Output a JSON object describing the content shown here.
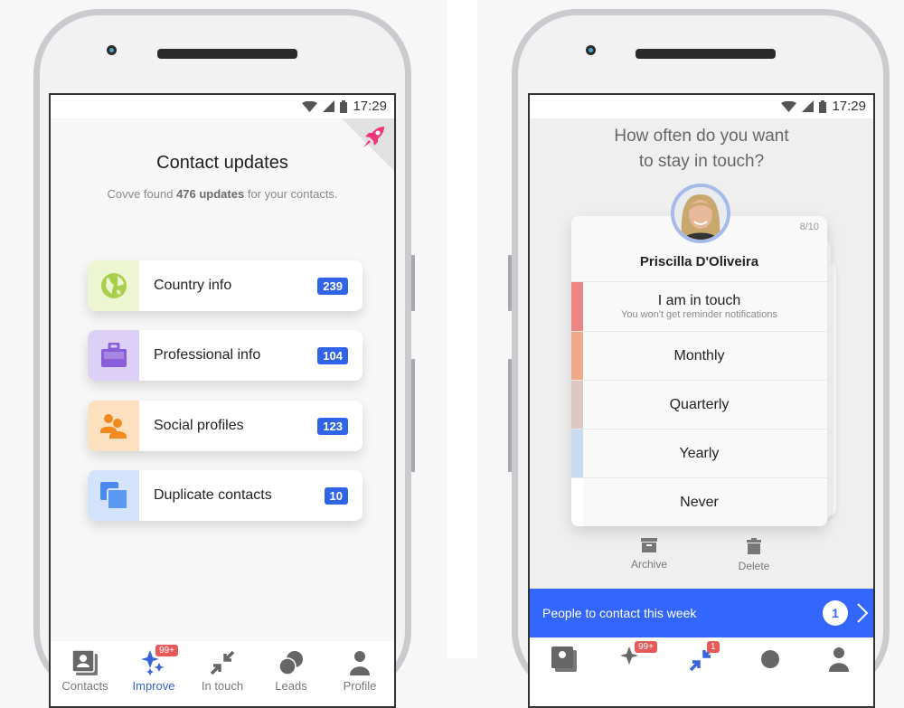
{
  "status_bar": {
    "time": "17:29"
  },
  "left_screen": {
    "title": "Contact updates",
    "subtitle_prefix": "Covve found ",
    "subtitle_bold": "476 updates",
    "subtitle_suffix": " for your contacts.",
    "cards": [
      {
        "label": "Country info",
        "count": "239",
        "icon": "globe-icon",
        "icon_bg": "#eef5d3",
        "icon_color": "#a8cf4c"
      },
      {
        "label": "Professional info",
        "count": "104",
        "icon": "briefcase-icon",
        "icon_bg": "#ddd0f6",
        "icon_color": "#8a5ed8"
      },
      {
        "label": "Social profiles",
        "count": "123",
        "icon": "people-icon",
        "icon_bg": "#fde0c0",
        "icon_color": "#f08a1e"
      },
      {
        "label": "Duplicate contacts",
        "count": "10",
        "icon": "duplicate-icon",
        "icon_bg": "#d4e3fb",
        "icon_color": "#4a8af0"
      }
    ],
    "nav": [
      {
        "label": "Contacts",
        "icon": "contacts-icon",
        "active": false
      },
      {
        "label": "Improve",
        "icon": "sparkle-icon",
        "active": true,
        "badge": "99+"
      },
      {
        "label": "In touch",
        "icon": "arrows-in-icon",
        "active": false
      },
      {
        "label": "Leads",
        "icon": "leads-icon",
        "active": false
      },
      {
        "label": "Profile",
        "icon": "profile-icon",
        "active": false
      }
    ]
  },
  "right_screen": {
    "question_line1": "How often do you want",
    "question_line2": "to stay in touch?",
    "counter": "8/10",
    "contact_name": "Priscilla D'Oliveira",
    "options": [
      {
        "label": "I am in touch",
        "sub": "You won't get reminder notifications",
        "color": "#ec8585"
      },
      {
        "label": "Monthly",
        "sub": "",
        "color": "#eeaa88"
      },
      {
        "label": "Quarterly",
        "sub": "",
        "color": "#dcc8c2"
      },
      {
        "label": "Yearly",
        "sub": "",
        "color": "#c9dbf0"
      },
      {
        "label": "Never",
        "sub": "",
        "color": "#ffffff"
      }
    ],
    "actions": [
      {
        "label": "Archive",
        "icon": "archive-icon"
      },
      {
        "label": "Delete",
        "icon": "trash-icon"
      }
    ],
    "cta": {
      "label": "People to contact this week",
      "count": "1"
    },
    "nav_badges": {
      "improve": "99+",
      "in_touch": "1"
    }
  },
  "colors": {
    "accent": "#2f64e8",
    "cta": "#3366ff",
    "badge_red": "#e85a5a",
    "rocket": "#f0357a"
  }
}
